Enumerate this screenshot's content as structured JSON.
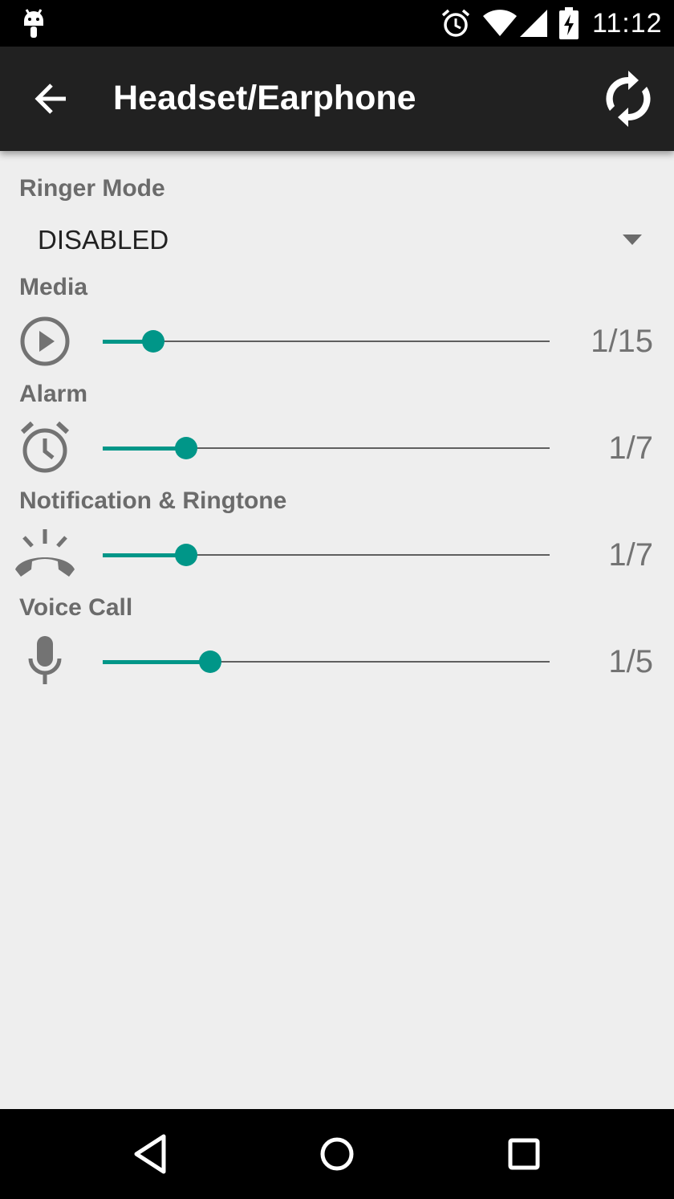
{
  "status_bar": {
    "time": "11:12",
    "icons": [
      "android-icon",
      "alarm-icon",
      "wifi-icon",
      "signal-icon",
      "battery-charging-icon"
    ]
  },
  "app_bar": {
    "title": "Headset/Earphone",
    "back_icon": "arrow-back-icon",
    "refresh_icon": "sync-icon"
  },
  "ringer_mode": {
    "label": "Ringer Mode",
    "selected": "DISABLED"
  },
  "volumes": [
    {
      "key": "media",
      "label": "Media",
      "icon": "play-circle-icon",
      "value": 1,
      "max": 15,
      "display": "1/15"
    },
    {
      "key": "alarm",
      "label": "Alarm",
      "icon": "alarm-clock-icon",
      "value": 1,
      "max": 7,
      "display": "1/7"
    },
    {
      "key": "notification",
      "label": "Notification & Ringtone",
      "icon": "ringing-phone-icon",
      "value": 1,
      "max": 7,
      "display": "1/7"
    },
    {
      "key": "voice",
      "label": "Voice Call",
      "icon": "microphone-icon",
      "value": 1,
      "max": 5,
      "display": "1/5"
    }
  ],
  "colors": {
    "accent": "#009688",
    "app_bar": "#212121",
    "background": "#eeeeee",
    "label": "#6b6b6b"
  },
  "nav_bar": {
    "buttons": [
      "back-triangle-icon",
      "home-circle-icon",
      "recents-square-icon"
    ]
  }
}
